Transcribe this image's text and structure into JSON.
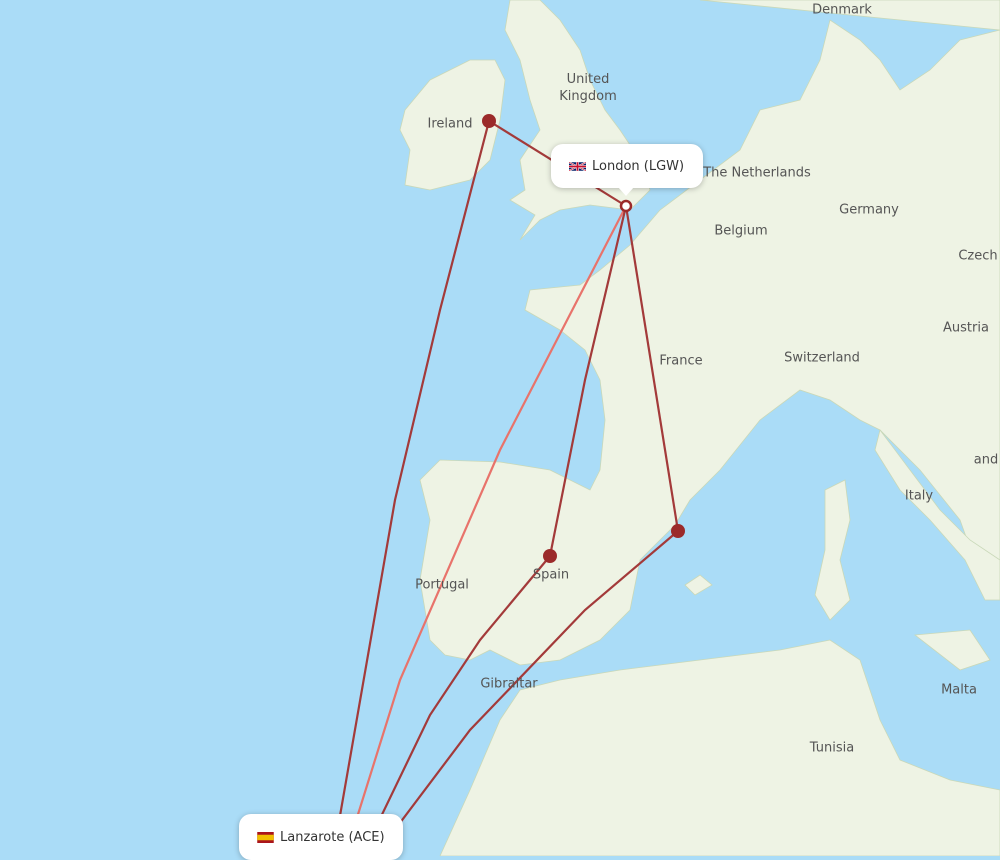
{
  "map": {
    "colors": {
      "sea": "#aadcf7",
      "land": "#eef3e4",
      "route": "#a33a3a",
      "route_highlight": "#e8736b",
      "airport": "#9b2a2a"
    },
    "labels": {
      "denmark": "Denmark",
      "uk": "United Kingdom",
      "ireland": "Ireland",
      "netherlands": "The Netherlands",
      "germany": "Germany",
      "belgium": "Belgium",
      "czech": "Czech",
      "austria": "Austria",
      "france": "France",
      "switzerland": "Switzerland",
      "and": "and",
      "italy": "Italy",
      "portugal": "Portugal",
      "spain": "Spain",
      "gibraltar": "Gibraltar",
      "malta": "Malta",
      "tunisia": "Tunisia"
    },
    "origin": {
      "label": "London (LGW)",
      "flag": "uk-flag-icon"
    },
    "destination": {
      "label": "Lanzarote (ACE)",
      "flag": "spain-flag-icon"
    }
  }
}
